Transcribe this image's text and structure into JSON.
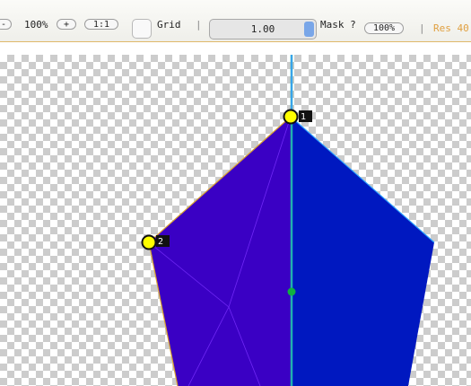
{
  "toolbar": {
    "zoom_out_label": "-",
    "zoom_value": "100%",
    "zoom_in_label": "+",
    "one_to_one_label": "1:1",
    "grid_label": "Grid",
    "separator": "|",
    "slider_value": "1.00",
    "mask_label": "Mask ?",
    "mask_value": "100%",
    "res_label": "Res 40"
  },
  "canvas": {
    "vertices": [
      {
        "label": "1",
        "color": "#ffff00"
      },
      {
        "label": "2",
        "color": "#ffff00"
      }
    ],
    "colors": {
      "left_fill": "#3a00c4",
      "right_fill": "#0018c0",
      "axis": "#20b0b0",
      "edge_left": "#d8a030",
      "edge_right": "#2aa0ff",
      "center_dot": "#10b040"
    }
  }
}
